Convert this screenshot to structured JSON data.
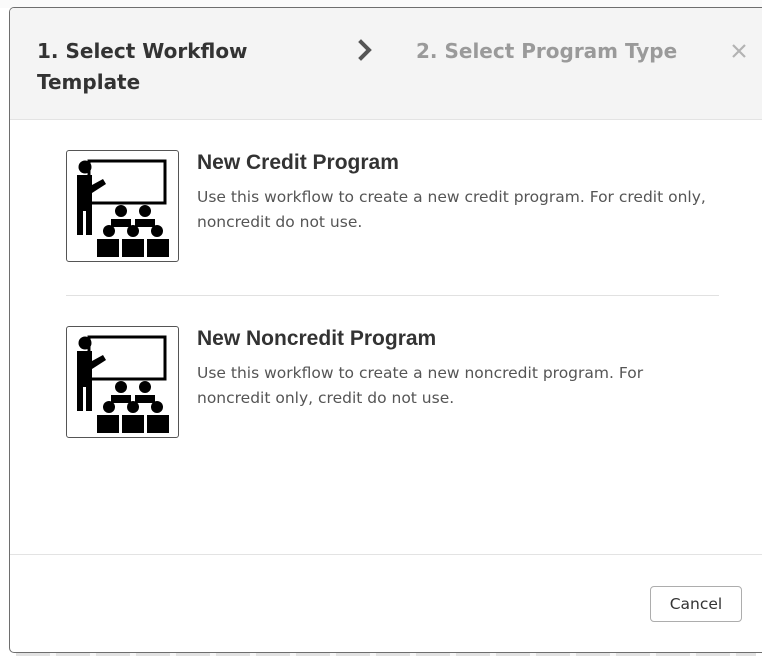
{
  "header": {
    "step1_label": "1. Select Workflow Template",
    "separator_icon": "chevron-right-icon",
    "step2_label": "2. Select Program Type",
    "close_icon": "close-icon"
  },
  "options": [
    {
      "title": "New Credit Program",
      "description": "Use this workflow to create a new credit program. For credit only, noncredit do not use.",
      "icon": "classroom-presenter-icon"
    },
    {
      "title": "New Noncredit Program",
      "description": "Use this workflow to create a new noncredit program. For noncredit only, credit do not use.",
      "icon": "classroom-presenter-icon"
    }
  ],
  "footer": {
    "cancel_label": "Cancel"
  },
  "colors": {
    "header_bg": "#f4f4f4",
    "active_step": "#333333",
    "inactive_step": "#9a9a9a",
    "border": "#6e6e6e"
  }
}
